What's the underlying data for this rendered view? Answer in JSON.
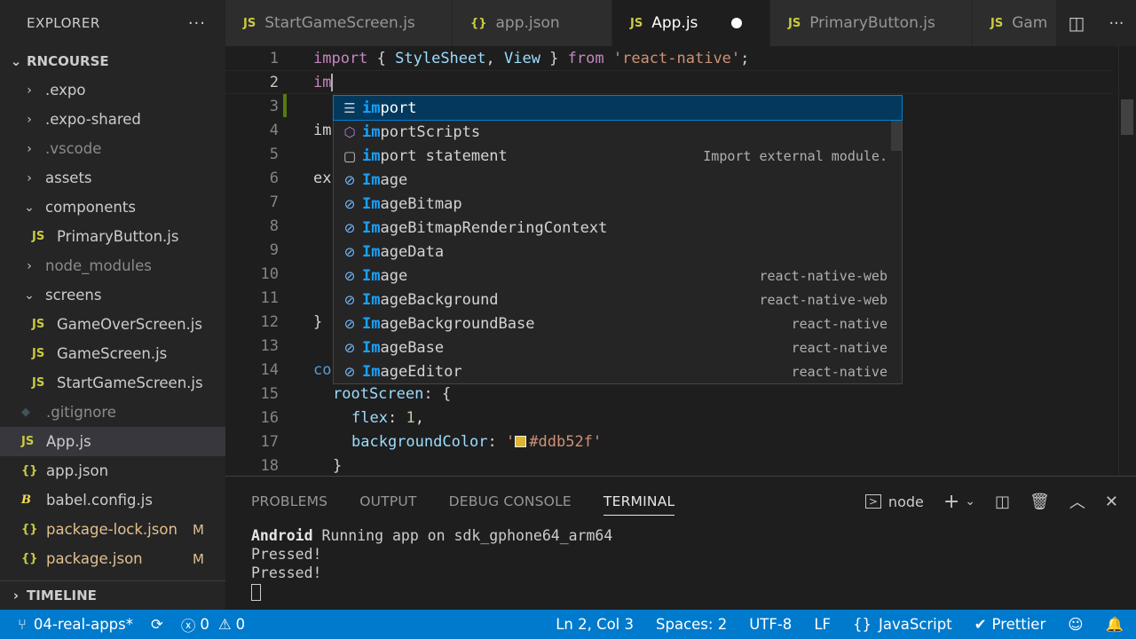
{
  "explorer": {
    "title": "EXPLORER",
    "more": "···",
    "root": "RNCOURSE",
    "items": [
      {
        "label": ".expo",
        "kind": "folder"
      },
      {
        "label": ".expo-shared",
        "kind": "folder"
      },
      {
        "label": ".vscode",
        "kind": "folder"
      },
      {
        "label": "assets",
        "kind": "folder"
      },
      {
        "label": "components",
        "kind": "folder-open"
      },
      {
        "label": "PrimaryButton.js",
        "kind": "js"
      },
      {
        "label": "node_modules",
        "kind": "folder"
      },
      {
        "label": "screens",
        "kind": "folder-open"
      },
      {
        "label": "GameOverScreen.js",
        "kind": "js"
      },
      {
        "label": "GameScreen.js",
        "kind": "js"
      },
      {
        "label": "StartGameScreen.js",
        "kind": "js"
      },
      {
        "label": ".gitignore",
        "kind": "git"
      },
      {
        "label": "App.js",
        "kind": "js"
      },
      {
        "label": "app.json",
        "kind": "json"
      },
      {
        "label": "babel.config.js",
        "kind": "babel"
      },
      {
        "label": "package-lock.json",
        "kind": "json",
        "badge": "M"
      },
      {
        "label": "package.json",
        "kind": "json",
        "badge": "M"
      }
    ],
    "timeline": "TIMELINE"
  },
  "tabs": [
    {
      "label": "StartGameScreen.js",
      "icon": "JS"
    },
    {
      "label": "app.json",
      "icon": "{}"
    },
    {
      "label": "App.js",
      "icon": "JS"
    },
    {
      "label": "PrimaryButton.js",
      "icon": "JS"
    },
    {
      "label": "Gam",
      "icon": "JS"
    }
  ],
  "editor": {
    "line_numbers": [
      "1",
      "2",
      "3",
      "4",
      "5",
      "6",
      "7",
      "8",
      "9",
      "10",
      "11",
      "12",
      "13",
      "14",
      "15",
      "16",
      "17",
      "18"
    ],
    "line1": {
      "kw1": "import",
      "brace_open": " { ",
      "id1": "StyleSheet",
      "comma": ", ",
      "id2": "View",
      "brace_close": " } ",
      "kw2": "from",
      "space": " ",
      "str": "'react-native'",
      "semi": ";"
    },
    "line2": "im",
    "line4": "im",
    "line6": "ex",
    "line12": "}",
    "line14": "co",
    "line15": {
      "prop": "rootScreen",
      "rest": ": {"
    },
    "line16": {
      "prop": "flex",
      "colon": ": ",
      "num": "1",
      "comma": ","
    },
    "line17": {
      "prop": "backgroundColor",
      "colon": ": ",
      "q": "'",
      "str": "#ddb52f'",
      "swatch_color": "#ddb52f"
    },
    "line18": "}"
  },
  "suggest": {
    "items": [
      {
        "match": "im",
        "rest": "port",
        "detail": "",
        "icon": "keyword-icon"
      },
      {
        "match": "im",
        "rest": "portScripts",
        "detail": "",
        "icon": "module-icon"
      },
      {
        "match": "im",
        "rest": "port statement",
        "detail": "Import external module.",
        "icon": "snippet-icon"
      },
      {
        "match": "Im",
        "rest": "age",
        "detail": "",
        "icon": "variable-icon"
      },
      {
        "match": "Im",
        "rest": "ageBitmap",
        "detail": "",
        "icon": "variable-icon"
      },
      {
        "match": "Im",
        "rest": "ageBitmapRenderingContext",
        "detail": "",
        "icon": "variable-icon"
      },
      {
        "match": "Im",
        "rest": "ageData",
        "detail": "",
        "icon": "variable-icon"
      },
      {
        "match": "Im",
        "rest": "age",
        "detail": "react-native-web",
        "icon": "variable-icon"
      },
      {
        "match": "Im",
        "rest": "ageBackground",
        "detail": "react-native-web",
        "icon": "variable-icon"
      },
      {
        "match": "Im",
        "rest": "ageBackgroundBase",
        "detail": "react-native",
        "icon": "variable-icon"
      },
      {
        "match": "Im",
        "rest": "ageBase",
        "detail": "react-native",
        "icon": "variable-icon"
      },
      {
        "match": "Im",
        "rest": "ageEditor",
        "detail": "react-native",
        "icon": "variable-icon"
      }
    ]
  },
  "panel": {
    "tabs": [
      "PROBLEMS",
      "OUTPUT",
      "DEBUG CONSOLE",
      "TERMINAL"
    ],
    "active_tab": "TERMINAL",
    "terminal_name": "node",
    "terminal_lines": [
      {
        "bold": "Android",
        "text": " Running app on sdk_gphone64_arm64"
      },
      {
        "bold": "",
        "text": "Pressed!"
      },
      {
        "bold": "",
        "text": "Pressed!"
      }
    ]
  },
  "status": {
    "branch": "04-real-apps*",
    "errors": "0",
    "warnings": "0",
    "position": "Ln 2, Col 3",
    "spaces": "Spaces: 2",
    "encoding": "UTF-8",
    "eol": "LF",
    "language": "JavaScript",
    "formatter": "Prettier"
  }
}
